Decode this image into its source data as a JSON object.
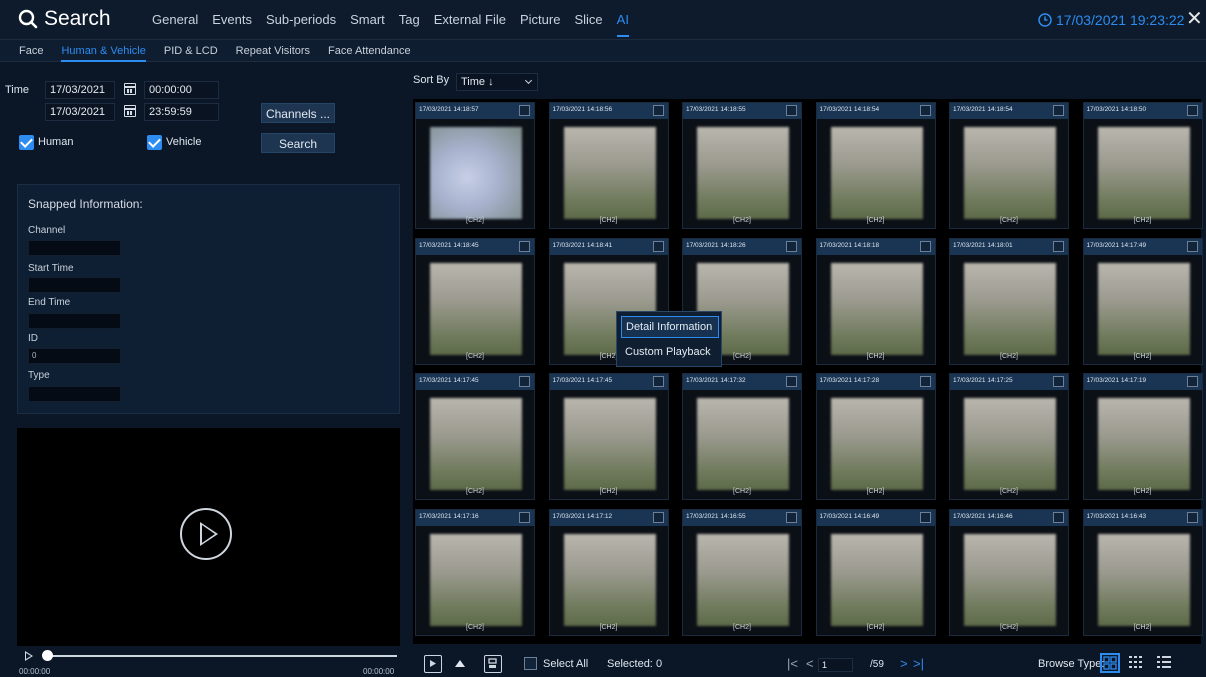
{
  "header": {
    "title": "Search",
    "tabs": [
      "General",
      "Events",
      "Sub-periods",
      "Smart",
      "Tag",
      "External File",
      "Picture",
      "Slice",
      "AI"
    ],
    "active_tab": "AI",
    "datetime": "17/03/2021 19:23:22"
  },
  "subtabs": {
    "items": [
      "Face",
      "Human & Vehicle",
      "PID & LCD",
      "Repeat Visitors",
      "Face Attendance"
    ],
    "active": "Human & Vehicle"
  },
  "filters": {
    "time_label": "Time",
    "start_date": "17/03/2021",
    "start_time": "00:00:00",
    "end_date": "17/03/2021",
    "end_time": "23:59:59",
    "channels_button": "Channels ...",
    "human_label": "Human",
    "human_checked": true,
    "vehicle_label": "Vehicle",
    "vehicle_checked": true,
    "search_button": "Search"
  },
  "snapped": {
    "title": "Snapped Information:",
    "channel_label": "Channel",
    "channel_value": "",
    "start_time_label": "Start Time",
    "start_time_value": "",
    "end_time_label": "End Time",
    "end_time_value": "",
    "id_label": "ID",
    "id_value": "0",
    "type_label": "Type",
    "type_value": ""
  },
  "player": {
    "time_start": "00:00:00",
    "time_end": "00:00:00",
    "progress": 0
  },
  "results": {
    "sort_label": "Sort By",
    "sort_value": "Time ↓",
    "items": [
      {
        "time": "17/03/2021 14:18:57",
        "channel": "[CH2]"
      },
      {
        "time": "17/03/2021 14:18:56",
        "channel": "[CH2]"
      },
      {
        "time": "17/03/2021 14:18:55",
        "channel": "[CH2]"
      },
      {
        "time": "17/03/2021 14:18:54",
        "channel": "[CH2]"
      },
      {
        "time": "17/03/2021 14:18:54",
        "channel": "[CH2]"
      },
      {
        "time": "17/03/2021 14:18:50",
        "channel": "[CH2]"
      },
      {
        "time": "17/03/2021 14:18:45",
        "channel": "[CH2]"
      },
      {
        "time": "17/03/2021 14:18:41",
        "channel": "[CH2]"
      },
      {
        "time": "17/03/2021 14:18:26",
        "channel": "[CH2]"
      },
      {
        "time": "17/03/2021 14:18:18",
        "channel": "[CH2]"
      },
      {
        "time": "17/03/2021 14:18:01",
        "channel": "[CH2]"
      },
      {
        "time": "17/03/2021 14:17:49",
        "channel": "[CH2]"
      },
      {
        "time": "17/03/2021 14:17:45",
        "channel": "[CH2]"
      },
      {
        "time": "17/03/2021 14:17:45",
        "channel": "[CH2]"
      },
      {
        "time": "17/03/2021 14:17:32",
        "channel": "[CH2]"
      },
      {
        "time": "17/03/2021 14:17:28",
        "channel": "[CH2]"
      },
      {
        "time": "17/03/2021 14:17:25",
        "channel": "[CH2]"
      },
      {
        "time": "17/03/2021 14:17:19",
        "channel": "[CH2]"
      },
      {
        "time": "17/03/2021 14:17:16",
        "channel": "[CH2]"
      },
      {
        "time": "17/03/2021 14:17:12",
        "channel": "[CH2]"
      },
      {
        "time": "17/03/2021 14:16:55",
        "channel": "[CH2]"
      },
      {
        "time": "17/03/2021 14:16:49",
        "channel": "[CH2]"
      },
      {
        "time": "17/03/2021 14:16:46",
        "channel": "[CH2]"
      },
      {
        "time": "17/03/2021 14:16:43",
        "channel": "[CH2]"
      }
    ]
  },
  "context_menu": {
    "items": [
      "Detail Information",
      "Custom Playback"
    ],
    "selected": "Detail Information"
  },
  "footer": {
    "select_all_label": "Select All",
    "selected_label": "Selected:",
    "selected_count": "0",
    "page_current": "1",
    "page_total": "/59",
    "browse_type_label": "Browse Type:"
  },
  "colors": {
    "accent": "#2d8cf0",
    "background": "#0b1727",
    "card_header": "#1a3553"
  },
  "icons": [
    "search-icon",
    "clock-icon",
    "close-icon",
    "calendar-icon",
    "play-icon",
    "save-icon",
    "first-page-icon",
    "prev-page-icon",
    "next-page-icon",
    "last-page-icon",
    "grid-view-icon",
    "list-view-icon"
  ]
}
